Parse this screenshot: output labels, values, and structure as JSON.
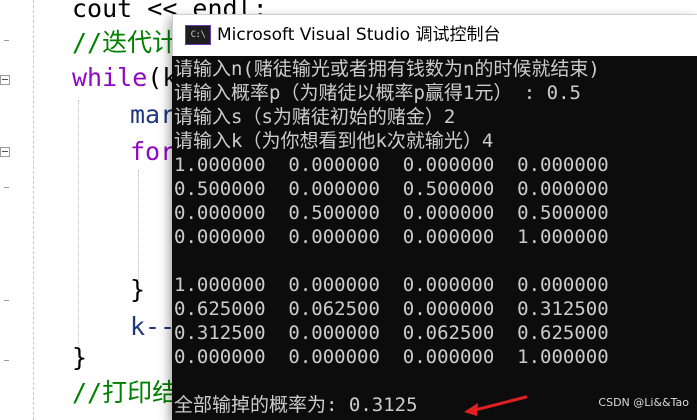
{
  "editor": {
    "lines": [
      {
        "parts": [
          {
            "cls": "",
            "text": "cout "
          },
          {
            "cls": "",
            "text": "<< "
          },
          {
            "cls": "",
            "text": "endl;"
          }
        ]
      },
      {
        "parts": [
          {
            "cls": "cm",
            "text": "//迭代计"
          }
        ]
      },
      {
        "parts": [
          {
            "cls": "kw2",
            "text": "while"
          },
          {
            "cls": "",
            "text": "(k"
          }
        ]
      },
      {
        "parts": [
          {
            "cls": "vr",
            "text": "mar"
          }
        ]
      },
      {
        "parts": [
          {
            "cls": "kw2",
            "text": "for"
          }
        ]
      },
      {
        "parts": [
          {
            "cls": "",
            "text": "}"
          }
        ]
      },
      {
        "parts": [
          {
            "cls": "vr",
            "text": "k--"
          }
        ]
      },
      {
        "parts": [
          {
            "cls": "",
            "text": "}"
          }
        ]
      },
      {
        "parts": [
          {
            "cls": "cm",
            "text": "//打印结"
          }
        ]
      }
    ]
  },
  "console": {
    "icon_label": "C:\\",
    "title": "Microsoft Visual Studio 调试控制台",
    "output": [
      "请输入n(赌徒输光或者拥有钱数为n的时候就结束)",
      "请输入概率p（为赌徒以概率p赢得1元） : 0.5",
      "请输入s（s为赌徒初始的赌金）2",
      "请输入k（为你想看到他k次就输光）4",
      "1.000000  0.000000  0.000000  0.000000",
      "0.500000  0.000000  0.500000  0.000000",
      "0.000000  0.500000  0.000000  0.500000",
      "0.000000  0.000000  0.000000  1.000000",
      "",
      "1.000000  0.000000  0.000000  0.000000",
      "0.625000  0.062500  0.000000  0.312500",
      "0.312500  0.000000  0.062500  0.625000",
      "0.000000  0.000000  0.000000  1.000000",
      "",
      "全部输掉的概率为: 0.3125"
    ]
  },
  "watermark": "CSDN @Li&&Tao",
  "colors": {
    "console_bg": "#0c0c0c",
    "console_text": "#cccccc",
    "arrow": "#e02020",
    "comment": "#008000",
    "keyword": "#8f08c4"
  }
}
